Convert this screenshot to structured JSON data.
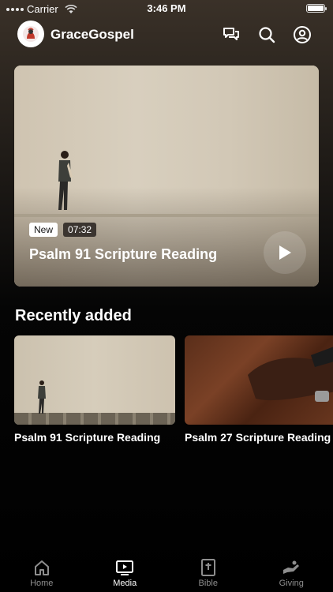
{
  "status_bar": {
    "carrier": "Carrier",
    "time": "3:46 PM"
  },
  "header": {
    "app_name": "GraceGospel",
    "icons": [
      "chat-icon",
      "search-icon",
      "profile-icon"
    ]
  },
  "hero": {
    "badge_new": "New",
    "duration": "07:32",
    "title": "Psalm 91 Scripture Reading",
    "play_icon": "play-icon"
  },
  "recently_added": {
    "title": "Recently added",
    "items": [
      {
        "title": "Psalm 91 Scripture Reading"
      },
      {
        "title": "Psalm 27 Scripture Reading"
      }
    ]
  },
  "tab_bar": {
    "active": "Media",
    "tabs": [
      {
        "label": "Home",
        "icon": "home-icon"
      },
      {
        "label": "Media",
        "icon": "media-icon"
      },
      {
        "label": "Bible",
        "icon": "bible-icon"
      },
      {
        "label": "Giving",
        "icon": "giving-icon"
      }
    ]
  },
  "colors": {
    "background": "#000000",
    "active_tab": "#ffffff",
    "inactive_tab": "#8e8e8e"
  }
}
